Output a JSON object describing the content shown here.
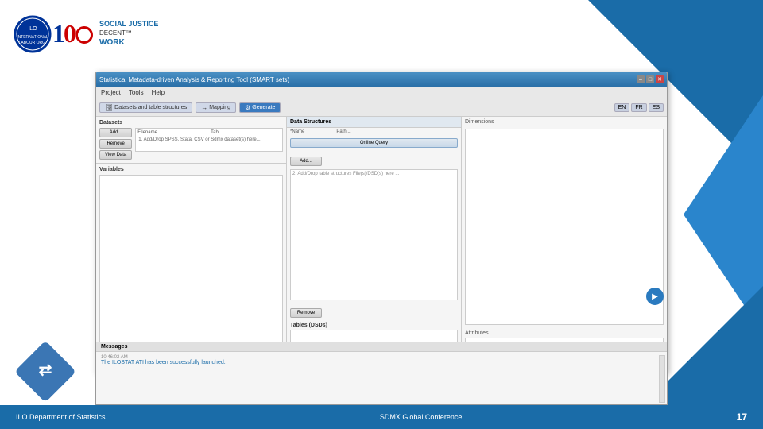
{
  "header": {
    "ilo_logo_alt": "ILO Logo",
    "hundred_logo_alt": "100 Years Logo",
    "social_text": "SOCIAL JUSTICE",
    "decent_text": "DECENT™",
    "work_text": "WORK"
  },
  "window": {
    "title": "Statistical Metadata-driven Analysis & Reporting Tool (SMART sets)",
    "controls": {
      "minimize": "–",
      "maximize": "□",
      "close": "✕"
    }
  },
  "menu": {
    "items": [
      "Project",
      "Tools",
      "Help"
    ]
  },
  "toolbar": {
    "tabs": [
      {
        "label": "Datasets and table structures",
        "icon": "🗄",
        "active": false
      },
      {
        "label": "Mapping",
        "icon": "🗺",
        "active": false
      },
      {
        "label": "Generate",
        "icon": "⚙",
        "active": true
      }
    ],
    "lang_buttons": [
      "EN",
      "FR",
      "ES"
    ]
  },
  "datasets_panel": {
    "label": "Datasets",
    "columns": [
      "Filename",
      "Tab..."
    ],
    "buttons": [
      "Add...",
      "Remove",
      "View Data"
    ],
    "hint": "1. Add/Drop SPSS, Stata, CSV or Sdmx dataset(s) here..."
  },
  "variables_panel": {
    "label": "Variables"
  },
  "data_structures": {
    "label": "Data Structures",
    "columns": [
      "*Name",
      "Path..."
    ],
    "online_query_btn": "Online Query",
    "add_btn": "Add...",
    "remove_btn": "Remove",
    "hint": "2. Add/Drop table structures File(s)/DSD(s) here ..."
  },
  "tables_panel": {
    "label": "Tables (DSDs)"
  },
  "dimensions_panel": {
    "label": "Dimensions"
  },
  "attributes_panel": {
    "label": "Attributes"
  },
  "messages_panel": {
    "label": "Messages",
    "timestamp": "10:46:02 AM",
    "message": "The ILOSTAT ATI has been successfully launched."
  },
  "footer": {
    "left": "ILO Department of Statistics",
    "center": "SDMX Global Conference",
    "page_number": "17"
  },
  "arrow_btn": "▶"
}
